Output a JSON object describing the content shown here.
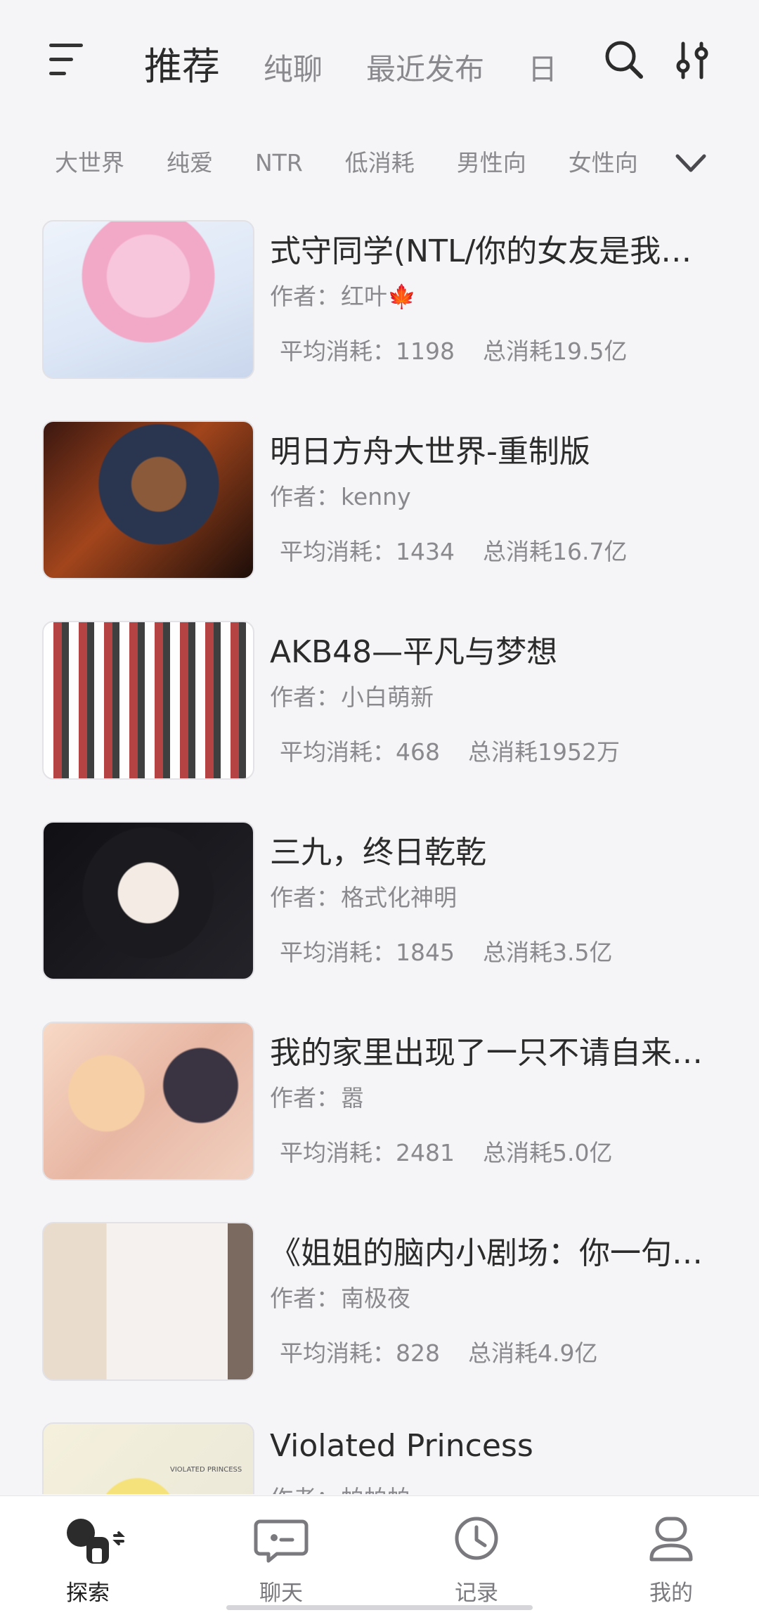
{
  "header": {
    "tabs": [
      {
        "label": "推荐",
        "active": true
      },
      {
        "label": "纯聊",
        "active": false
      },
      {
        "label": "最近发布",
        "active": false
      },
      {
        "label": "日",
        "active": false
      }
    ],
    "menu_icon": "menu-icon",
    "search_icon": "search-icon",
    "filter_icon": "sliders-icon"
  },
  "categories": [
    "大世界",
    "纯爱",
    "NTR",
    "低消耗",
    "男性向",
    "女性向"
  ],
  "expand_icon": "chevron-down-icon",
  "items": [
    {
      "title": "式守同学(NTL/你的女友是我…",
      "author_label": "作者：",
      "author": "红叶🍁",
      "avg_label": "平均消耗：",
      "avg": "1198",
      "total_label": "总消耗",
      "total": "19.5亿"
    },
    {
      "title": "明日方舟大世界-重制版",
      "author_label": "作者：",
      "author": "kenny",
      "avg_label": "平均消耗：",
      "avg": "1434",
      "total_label": "总消耗",
      "total": "16.7亿"
    },
    {
      "title": "AKB48—平凡与梦想",
      "author_label": "作者：",
      "author": "小白萌新",
      "avg_label": "平均消耗：",
      "avg": "468",
      "total_label": "总消耗",
      "total": "1952万"
    },
    {
      "title": "三九，终日乾乾",
      "author_label": "作者：",
      "author": "格式化神明",
      "avg_label": "平均消耗：",
      "avg": "1845",
      "total_label": "总消耗",
      "total": "3.5亿"
    },
    {
      "title": "我的家里出现了一只不请自来…",
      "author_label": "作者：",
      "author": "嚣",
      "avg_label": "平均消耗：",
      "avg": "2481",
      "total_label": "总消耗",
      "total": "5.0亿"
    },
    {
      "title": "《姐姐的脑内小剧场：你一句…",
      "author_label": "作者：",
      "author": "南极夜",
      "avg_label": "平均消耗：",
      "avg": "828",
      "total_label": "总消耗",
      "total": "4.9亿"
    },
    {
      "title": "Violated Princess",
      "author_label": "作者：",
      "author": "帕帕帕",
      "thumb_text": "VIOLATED PRINCESS"
    }
  ],
  "bottom_nav": [
    {
      "label": "探索",
      "icon": "explore-icon",
      "active": true
    },
    {
      "label": "聊天",
      "icon": "chat-icon",
      "active": false
    },
    {
      "label": "记录",
      "icon": "clock-icon",
      "active": false
    },
    {
      "label": "我的",
      "icon": "profile-icon",
      "active": false
    }
  ]
}
